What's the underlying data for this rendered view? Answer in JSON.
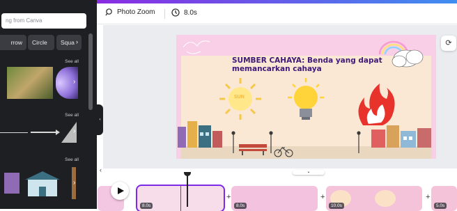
{
  "left_panel": {
    "search_text": "ng from Canva",
    "chips": [
      "rrow",
      "Circle",
      "Squa"
    ],
    "see_all": [
      "See all",
      "See all",
      "See all"
    ]
  },
  "toolbar": {
    "photo_zoom_label": "Photo Zoom",
    "duration_label": "8.0s"
  },
  "slide": {
    "title": "SUMBER CAHAYA: Benda yang dapat memancarkan cahaya",
    "sun_label": "SUN"
  },
  "timeline": {
    "pages": [
      {
        "duration": "8.0s"
      },
      {
        "duration": ""
      },
      {
        "duration": "8.0s"
      },
      {
        "duration": ""
      },
      {
        "duration": "10.0s"
      },
      {
        "duration": ""
      },
      {
        "duration": "5.0s"
      }
    ]
  },
  "colors": {
    "accent": "#7d2ae8",
    "panel_bg": "#1e1f23",
    "slide_border": "#f9cfe8",
    "title_color": "#3d1a7a"
  }
}
